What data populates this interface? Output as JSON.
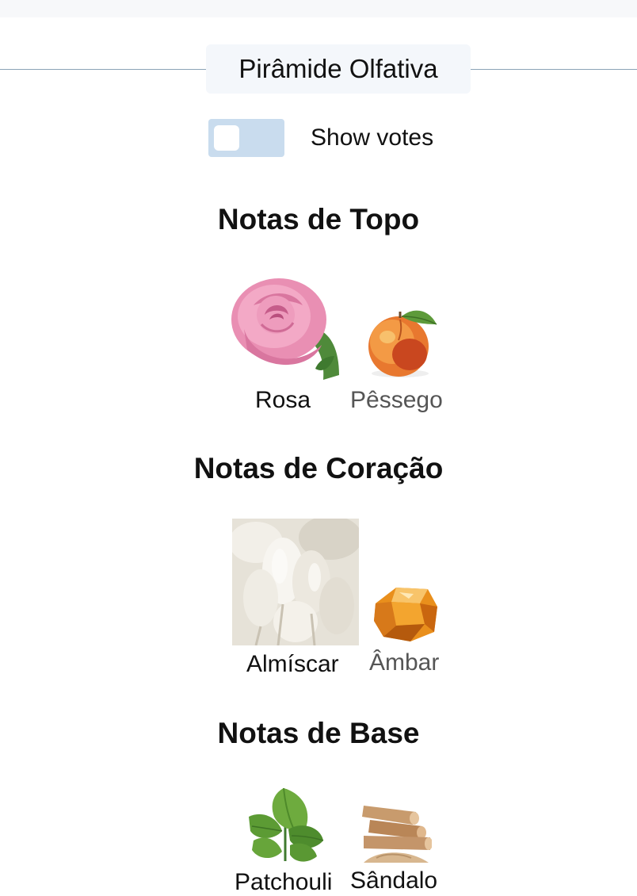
{
  "header": {
    "title": "Pirâmide Olfativa"
  },
  "toggle": {
    "label": "Show votes",
    "on": false
  },
  "sections": [
    {
      "title": "Notas de Topo",
      "notes": [
        {
          "name": "Rosa",
          "icon": "rose-image"
        },
        {
          "name": "Pêssego",
          "icon": "peach-image"
        }
      ]
    },
    {
      "title": "Notas de Coração",
      "notes": [
        {
          "name": "Almíscar",
          "icon": "musk-image"
        },
        {
          "name": "Âmbar",
          "icon": "amber-image"
        }
      ]
    },
    {
      "title": "Notas de Base",
      "notes": [
        {
          "name": "Patchouli",
          "icon": "patchouli-image"
        },
        {
          "name": "Sândalo",
          "icon": "sandalwood-image"
        }
      ]
    }
  ]
}
